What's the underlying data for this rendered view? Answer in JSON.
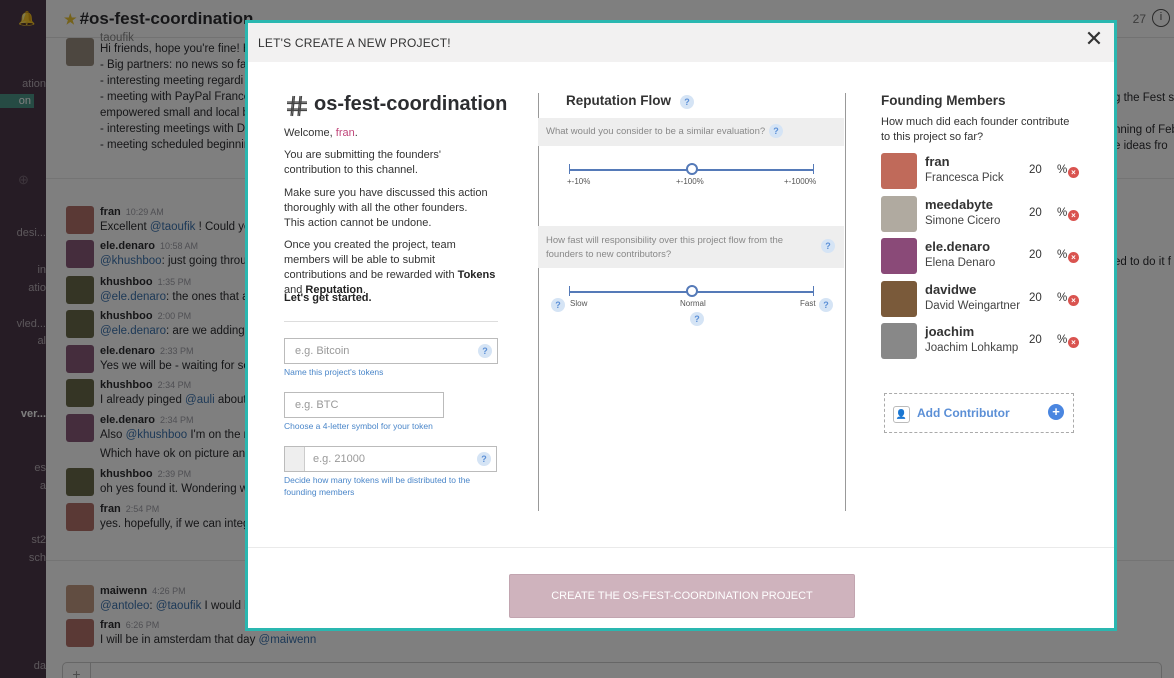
{
  "sidebar": {
    "items": [
      "ation",
      "on",
      "desi...",
      "in",
      "atio",
      "vled...",
      "al",
      "ver...",
      "es",
      "a",
      "st2",
      "sch",
      "da"
    ]
  },
  "chat": {
    "channel": "#os-fest-coordination",
    "member_count": "27",
    "info_icon": "i",
    "top_lines": [
      "Hi friends, hope you're fine! H",
      "- Big partners: no news so far",
      "- interesting meeting  regardi",
      "- meeting with PayPal France",
      "empowered small and local bu",
      "- interesting meetings with De",
      "- meeting scheduled beginnin"
    ],
    "top_partial_name": "taoufik",
    "right_fragments": [
      "g the Fest se",
      "nning of Feb",
      "e ideas fro",
      "ed to do it f"
    ],
    "messages": [
      {
        "name": "fran",
        "time": "10:29 AM",
        "text": "Excellent ",
        "mention": "@taoufik",
        "after": " ! Could yo"
      },
      {
        "name": "ele.denaro",
        "time": "10:58 AM",
        "text": "",
        "mention": "@khushboo",
        "after": ": just going throug"
      },
      {
        "name": "khushboo",
        "time": "1:35 PM",
        "text": "",
        "mention": "@ele.denaro",
        "after": ": the ones that ar"
      },
      {
        "name": "khushboo",
        "time": "2:00 PM",
        "text": "",
        "mention": "@ele.denaro",
        "after": ": are we adding n"
      },
      {
        "name": "ele.denaro",
        "time": "2:33 PM",
        "text": "Yes we will be - waiting for so",
        "mention": "",
        "after": ""
      },
      {
        "name": "khushboo",
        "time": "2:34 PM",
        "text": "I already pinged ",
        "mention": "@auli",
        "after": " about i"
      },
      {
        "name": "ele.denaro",
        "time": "2:34 PM",
        "text": "Also ",
        "mention": "@khushboo",
        "after": " I'm on the ro"
      },
      {
        "name": "khushboo",
        "time": "2:39 PM",
        "text": "oh yes found it. Wondering w",
        "mention": "",
        "after": ""
      },
      {
        "name": "fran",
        "time": "2:54 PM",
        "text": "yes. hopefully, if we can integ",
        "mention": "",
        "after": ""
      }
    ],
    "extra_line": "Which have ok on picture and",
    "bottom_messages": [
      {
        "name": "maiwenn",
        "time": "4:26 PM",
        "text": "",
        "mention": "@antoleo",
        "mid": ": ",
        "mention2": "@taoufik",
        "after": " I would li"
      },
      {
        "name": "fran",
        "time": "6:26 PM",
        "text": "I will be in amsterdam that day ",
        "mention": "@maiwenn",
        "mid": "",
        "mention2": "",
        "after": ""
      }
    ]
  },
  "modal": {
    "title": "LET'S CREATE A NEW PROJECT!",
    "close_glyph": "✕",
    "project_name": "os-fest-coordination",
    "welcome_prefix": "Welcome, ",
    "welcome_user": "fran",
    "welcome_suffix": ".",
    "para1": "You are submitting the founders' contribution to this channel.",
    "para2": "Make sure you have discussed this action thoroughly with all the other founders. This action cannot be undone.",
    "para3_prefix": "Once you created the project, team members will be able to submit contributions and be rewarded with ",
    "para3_tokens": "Tokens",
    "para3_and": " and ",
    "para3_rep": "Reputation",
    "para3_end": ".",
    "get_started": "Let's get started.",
    "token_name": {
      "placeholder": "e.g. Bitcoin",
      "hint": "Name this project's tokens"
    },
    "token_symbol": {
      "placeholder": "e.g. BTC",
      "hint": "Choose a 4-letter symbol for your token"
    },
    "token_amount": {
      "placeholder": "e.g. 21000",
      "hint": "Decide how many tokens will be distributed to the founding members"
    },
    "q_glyph": "?",
    "reputation": {
      "title": "Reputation Flow",
      "q1": "What would you consider to be a similar evaluation?",
      "slider1": {
        "labels": [
          "+-10%",
          "+-100%",
          "+-1000%"
        ],
        "value": 0.5
      },
      "q2": "How fast will responsibility over this project flow from the founders to new contributors?",
      "slider2": {
        "labels": [
          "Slow",
          "Normal",
          "Fast"
        ],
        "value": 0.5
      }
    },
    "founders": {
      "title": "Founding Members",
      "question": "How much did each founder contribute to this project so far?",
      "members": [
        {
          "nick": "fran",
          "name": "Francesca Pick",
          "value": "20",
          "pct": "%"
        },
        {
          "nick": "meedabyte",
          "name": "Simone Cicero",
          "value": "20",
          "pct": "%"
        },
        {
          "nick": "ele.denaro",
          "name": "Elena Denaro",
          "value": "20",
          "pct": "%"
        },
        {
          "nick": "davidwe",
          "name": "David Weingartner",
          "value": "20",
          "pct": "%"
        },
        {
          "nick": "joachim",
          "name": "Joachim Lohkamp",
          "value": "20",
          "pct": "%"
        }
      ],
      "remove_glyph": "×",
      "add_label": "Add Contributor",
      "add_glyph": "+"
    },
    "create_button": "CREATE THE OS-FEST-COORDINATION PROJECT"
  },
  "colors": {
    "accent": "#2ab7b0",
    "sidebar": "#4d394b",
    "button": "#cfb3bd",
    "link": "#4a86c9",
    "remove": "#d9534f"
  }
}
